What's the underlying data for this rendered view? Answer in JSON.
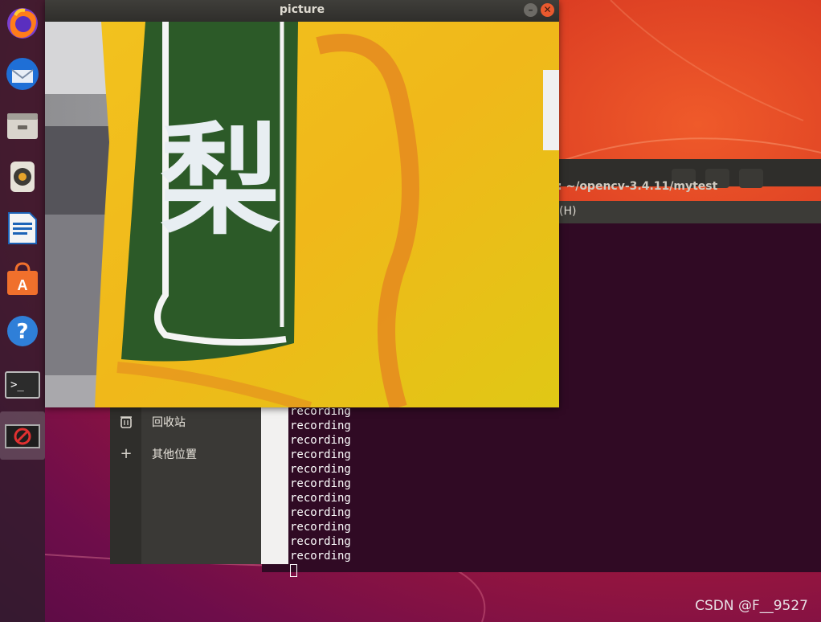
{
  "picture_window": {
    "title": "picture",
    "minimize_glyph": "–",
    "close_glyph": "✕",
    "photo_text": "梨"
  },
  "terminal": {
    "title": ": ~/opencv-3.4.11/mytest",
    "menu_help": "(H)",
    "lines": [
      "recording",
      "recording",
      "recording",
      "recording",
      "recording",
      "recording",
      "recording",
      "recording",
      "recording",
      "recording",
      "recording"
    ]
  },
  "file_manager": {
    "items": [
      {
        "icon": "trash-icon",
        "label": "回收站"
      },
      {
        "icon": "plus-icon",
        "label": "其他位置"
      }
    ]
  },
  "dock": {
    "apps": [
      "firefox-icon",
      "thunderbird-icon",
      "files-icon",
      "rhythmbox-icon",
      "writer-icon",
      "software-center-icon",
      "help-icon",
      "terminal-icon",
      "no-entry-icon"
    ]
  },
  "watermark": "CSDN @F__9527",
  "colors": {
    "terminal_bg": "#300a24",
    "titlebar": "#2f2e2b",
    "close_button": "#e9592e",
    "desktop_orange": "#ef5a2a",
    "desktop_purple": "#6e0d4a"
  }
}
